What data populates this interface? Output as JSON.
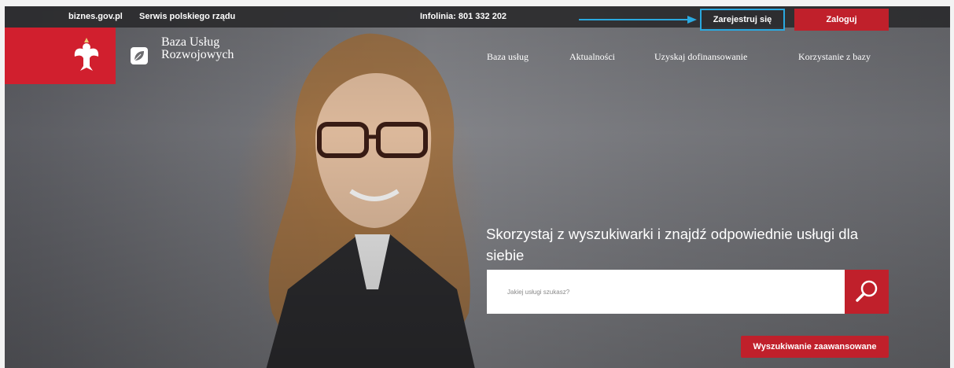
{
  "topbar": {
    "links": [
      "biznes.gov.pl",
      "Serwis polskiego rządu"
    ],
    "infoline": "Infolinia: 801 332 202",
    "register_label": "Zarejestruj się",
    "login_label": "Zaloguj"
  },
  "brand": {
    "name_line1": "Baza Usług",
    "name_line2": "Rozwojowych",
    "emblem_icon": "polish-eagle-emblem",
    "logo_icon": "leaf-icon"
  },
  "nav": {
    "items": [
      "Baza usług",
      "Aktualności",
      "Uzyskaj dofinansowanie",
      "Korzystanie z bazy"
    ]
  },
  "hero": {
    "heading": "Skorzystaj z wyszukiwarki i znajdź odpowiednie usługi dla siebie",
    "search_placeholder": "Jakiej usługi szukasz?",
    "search_icon": "search-icon",
    "advanced_label": "Wyszukiwanie zaawansowane"
  },
  "colors": {
    "accent_red": "#c0202b",
    "highlight_blue": "#2aa9e0"
  }
}
